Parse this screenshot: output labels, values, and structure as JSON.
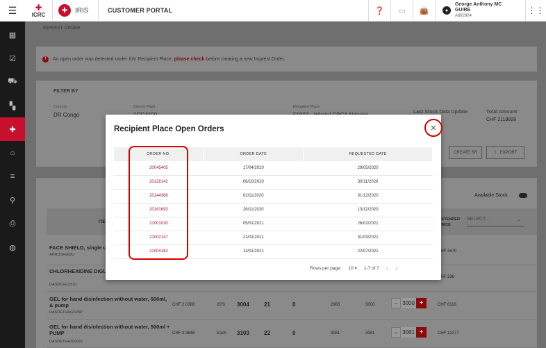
{
  "header": {
    "logo_text": "ICRC",
    "iris_text": "IRIS",
    "portal_title": "CUSTOMER PORTAL",
    "user_name": "George Anthony MC GUIRE",
    "user_id": "A892904"
  },
  "breadcrumb": "IMPREST ORDER",
  "alert": {
    "text_before": "An open order was detected under this Recipient Place,",
    "link": "please check",
    "text_after": "before creating a new Imprest Order."
  },
  "filter": {
    "label": "FILTER BY",
    "country_label": "Country",
    "country_value": "DR Congo",
    "branch_label": "Branch Plant",
    "branch_value": "1CG4100",
    "recipient_label": "Recipient Place",
    "recipient_value": "51007 - Hôpital CBCA Ndosho",
    "last_stock_label": "Last Stock Data Update",
    "total_amount_label": "Total Amount",
    "total_amount_value": "CHF 2119828",
    "create_sr": "CREATE SR",
    "export": "EXPORT"
  },
  "list": {
    "available_stock": "Available Stock",
    "col_item": "ITE",
    "col_extended": "EXTENDED PRICE",
    "select_placeholder": "SELECT...",
    "rows": [
      {
        "name": "FACE SHIELD, single u",
        "code": "APROSHIESU",
        "price": "",
        "unit": "",
        "a": "",
        "b": "",
        "c": "",
        "d": "",
        "e": "",
        "qty": "",
        "ext": "CHF 3470"
      },
      {
        "name": "CHLORHEXIDINE DIGL solution, 1L, btl.",
        "code": "DASDCHLC5S1",
        "price": "",
        "unit": "",
        "a": "",
        "b": "",
        "c": "",
        "d": "",
        "e": "",
        "qty": "",
        "ext": "CHF 238"
      },
      {
        "name": "GEL for hand disinfection without water, 500ml, & pump",
        "code": "DASDETHAGS00P",
        "price": "CHF 2.0386",
        "unit": "20'S",
        "a": "3004",
        "b": "21",
        "c": "0",
        "d": "2983",
        "e": "3000",
        "qty": "3000",
        "ext": "CHF 6116"
      },
      {
        "name": "GEL for hand disinfection without water, 500ml + PUMP",
        "code": "DASDETHAZ00001",
        "price": "CHF 3.9648",
        "unit": "Each",
        "a": "3103",
        "b": "22",
        "c": "0",
        "d": "3081",
        "e": "3081",
        "qty": "3081",
        "ext": "CHF 12277"
      }
    ]
  },
  "modal": {
    "title": "Recipient Place Open Orders",
    "columns": [
      "ORDER NO.",
      "ORDER DATE",
      "REQUESTED DATE"
    ],
    "rows": [
      {
        "order_no": "20045405",
        "order_date": "17/04/2020",
        "requested_date": "29/05/2020"
      },
      {
        "order_no": "20128142",
        "order_date": "06/10/2020",
        "requested_date": "30/11/2020"
      },
      {
        "order_no": "20144368",
        "order_date": "02/11/2020",
        "requested_date": "31/12/2020"
      },
      {
        "order_no": "20161693",
        "order_date": "26/11/2020",
        "requested_date": "13/12/2020"
      },
      {
        "order_no": "21001030",
        "order_date": "05/01/2021",
        "requested_date": "26/02/2021"
      },
      {
        "order_no": "21002147",
        "order_date": "21/01/2021",
        "requested_date": "31/03/2021"
      },
      {
        "order_no": "21004182",
        "order_date": "13/01/2021",
        "requested_date": "22/07/2021"
      }
    ],
    "rows_per_page_label": "Rows per page:",
    "rows_per_page_value": "10",
    "page_range": "1-7 of 7"
  },
  "colors": {
    "accent": "#c8102e",
    "link": "#9b1c2c",
    "highlight": "#d40000"
  }
}
